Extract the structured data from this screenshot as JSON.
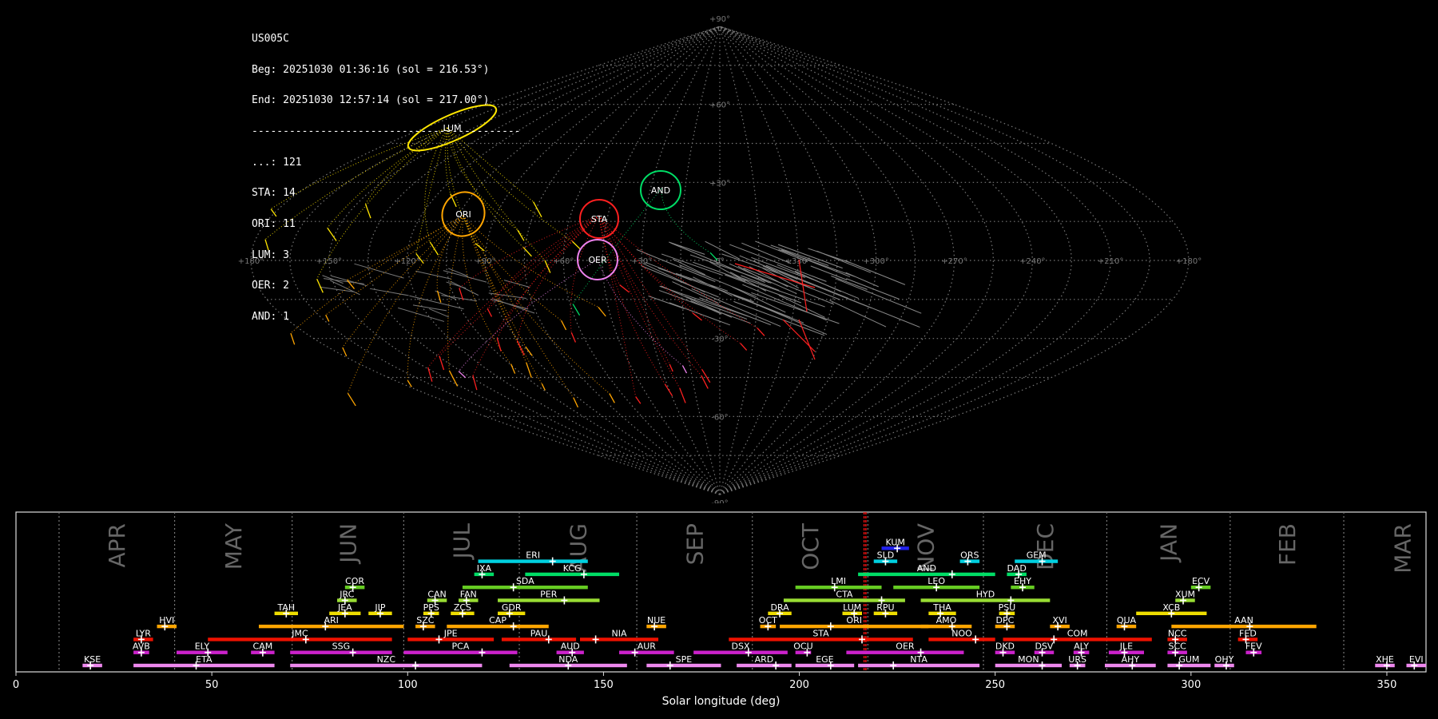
{
  "info": {
    "station": "US005C",
    "begin": "Beg: 20251030 01:36:16 (sol = 216.53°)",
    "end": "End: 20251030 12:57:14 (sol = 217.00°)",
    "separator": "-------------------------------------------",
    "counts": [
      "...: 121",
      "STA: 14",
      "ORI: 11",
      "LUM: 3",
      "OER: 2",
      "AND: 1"
    ]
  },
  "chart_data": [
    {
      "type": "scatter",
      "description": "Sinusoidal sky map of meteor trails and radiants",
      "lat_ticks": [
        "+90°",
        "+60°",
        "+30°",
        "0°",
        "-30°",
        "-60°",
        "-90°"
      ],
      "lon_ticks": [
        "+180°",
        "+150°",
        "+120°",
        "+90°",
        "+60°",
        "+30°",
        "0°",
        "+330°",
        "+300°",
        "+270°",
        "+240°",
        "+210°",
        "+180°"
      ],
      "grid": true,
      "radiants": [
        {
          "code": "LUM",
          "lon": 103,
          "lat": 48,
          "color": "#ffe600"
        },
        {
          "code": "ORI",
          "lon": 96,
          "lat": 15,
          "color": "#ffa500"
        },
        {
          "code": "STA",
          "lon": 51,
          "lat": 15,
          "color": "#ff2020"
        },
        {
          "code": "AND",
          "lon": 20,
          "lat": 25,
          "color": "#00dd66"
        },
        {
          "code": "OER",
          "lon": 46,
          "lat": 0,
          "color": "#ee82ee"
        }
      ]
    },
    {
      "type": "bar",
      "description": "Meteor shower activity periods vs solar longitude",
      "xlabel": "Solar longitude (deg)",
      "xlim": [
        0,
        360
      ],
      "xticks": [
        0,
        50,
        100,
        150,
        200,
        250,
        300,
        350
      ],
      "months": [
        {
          "name": "APR",
          "start": 11
        },
        {
          "name": "MAY",
          "start": 40.5
        },
        {
          "name": "JUN",
          "start": 70.5
        },
        {
          "name": "JUL",
          "start": 99
        },
        {
          "name": "AUG",
          "start": 128.5
        },
        {
          "name": "SEP",
          "start": 158.5
        },
        {
          "name": "OCT",
          "start": 188
        },
        {
          "name": "NOV",
          "start": 217.5
        },
        {
          "name": "DEC",
          "start": 247
        },
        {
          "name": "JAN",
          "start": 278.5
        },
        {
          "name": "FEB",
          "start": 310
        },
        {
          "name": "MAR",
          "start": 339
        }
      ],
      "current_sol": [
        216.53,
        217.0
      ],
      "showers": [
        {
          "code": "KUM",
          "start": 221,
          "end": 228,
          "peak": 225,
          "row": 10,
          "color": "#2222ee"
        },
        {
          "code": "ERI",
          "start": 118,
          "end": 146,
          "peak": 137,
          "row": 9,
          "color": "#00d0e0"
        },
        {
          "code": "SLD",
          "start": 219,
          "end": 225,
          "peak": 222,
          "row": 9,
          "color": "#00d0e0"
        },
        {
          "code": "ORS",
          "start": 241,
          "end": 246,
          "peak": 243,
          "row": 9,
          "color": "#00d0e0"
        },
        {
          "code": "GEM",
          "start": 255,
          "end": 266,
          "peak": 262,
          "row": 9,
          "color": "#00d0e0"
        },
        {
          "code": "IXA",
          "start": 117,
          "end": 122,
          "peak": 119,
          "row": 8,
          "color": "#00dd66"
        },
        {
          "code": "KCG",
          "start": 130,
          "end": 154,
          "peak": 145,
          "row": 8,
          "color": "#00dd66"
        },
        {
          "code": "AND",
          "start": 215,
          "end": 250,
          "peak": 239,
          "row": 8,
          "color": "#00dd66"
        },
        {
          "code": "DAD",
          "start": 253,
          "end": 258,
          "peak": 256,
          "row": 8,
          "color": "#00dd66"
        },
        {
          "code": "COR",
          "start": 84,
          "end": 89,
          "peak": 86,
          "row": 7,
          "color": "#66cc22"
        },
        {
          "code": "SDA",
          "start": 114,
          "end": 146,
          "peak": 127,
          "row": 7,
          "color": "#66cc22"
        },
        {
          "code": "LMI",
          "start": 199,
          "end": 221,
          "peak": 209,
          "row": 7,
          "color": "#66cc22"
        },
        {
          "code": "LEO",
          "start": 224,
          "end": 246,
          "peak": 235,
          "row": 7,
          "color": "#66cc22"
        },
        {
          "code": "EHY",
          "start": 254,
          "end": 260,
          "peak": 257,
          "row": 7,
          "color": "#66cc22"
        },
        {
          "code": "ECV",
          "start": 300,
          "end": 305,
          "peak": 302,
          "row": 7,
          "color": "#66cc22"
        },
        {
          "code": "JRC",
          "start": 82,
          "end": 87,
          "peak": 84,
          "row": 6,
          "color": "#99dd33"
        },
        {
          "code": "CAN",
          "start": 105,
          "end": 110,
          "peak": 107,
          "row": 6,
          "color": "#99dd33"
        },
        {
          "code": "FAN",
          "start": 113,
          "end": 118,
          "peak": 115,
          "row": 6,
          "color": "#99dd33"
        },
        {
          "code": "PER",
          "start": 123,
          "end": 149,
          "peak": 140,
          "row": 6,
          "color": "#99dd33"
        },
        {
          "code": "CTA",
          "start": 196,
          "end": 227,
          "peak": 221,
          "row": 6,
          "color": "#99dd33"
        },
        {
          "code": "HYD",
          "start": 231,
          "end": 264,
          "peak": 254,
          "row": 6,
          "color": "#99dd33"
        },
        {
          "code": "XUM",
          "start": 296,
          "end": 301,
          "peak": 298,
          "row": 6,
          "color": "#99dd33"
        },
        {
          "code": "TAH",
          "start": 66,
          "end": 72,
          "peak": 69,
          "row": 5,
          "color": "#eedd00"
        },
        {
          "code": "JEA",
          "start": 80,
          "end": 88,
          "peak": 84,
          "row": 5,
          "color": "#eedd00"
        },
        {
          "code": "JIP",
          "start": 90,
          "end": 96,
          "peak": 93,
          "row": 5,
          "color": "#eedd00"
        },
        {
          "code": "PPS",
          "start": 104,
          "end": 108,
          "peak": 106,
          "row": 5,
          "color": "#eedd00"
        },
        {
          "code": "ZCS",
          "start": 111,
          "end": 117,
          "peak": 114,
          "row": 5,
          "color": "#eedd00"
        },
        {
          "code": "GDR",
          "start": 123,
          "end": 130,
          "peak": 126,
          "row": 5,
          "color": "#eedd00"
        },
        {
          "code": "DRA",
          "start": 192,
          "end": 198,
          "peak": 195,
          "row": 5,
          "color": "#eedd00"
        },
        {
          "code": "LUM",
          "start": 211,
          "end": 216,
          "peak": 214,
          "row": 5,
          "color": "#eedd00"
        },
        {
          "code": "RPU",
          "start": 219,
          "end": 225,
          "peak": 222,
          "row": 5,
          "color": "#eedd00"
        },
        {
          "code": "THA",
          "start": 233,
          "end": 240,
          "peak": 236,
          "row": 5,
          "color": "#eedd00"
        },
        {
          "code": "PSU",
          "start": 251,
          "end": 255,
          "peak": 253,
          "row": 5,
          "color": "#eedd00"
        },
        {
          "code": "XCB",
          "start": 286,
          "end": 304,
          "peak": 295,
          "row": 5,
          "color": "#eedd00"
        },
        {
          "code": "HVI",
          "start": 36,
          "end": 41,
          "peak": 38,
          "row": 4,
          "color": "#ffa500"
        },
        {
          "code": "ARI",
          "start": 62,
          "end": 99,
          "peak": 79,
          "row": 4,
          "color": "#ffa500"
        },
        {
          "code": "SZC",
          "start": 102,
          "end": 107,
          "peak": 104,
          "row": 4,
          "color": "#ffa500"
        },
        {
          "code": "CAP",
          "start": 110,
          "end": 136,
          "peak": 127,
          "row": 4,
          "color": "#ffa500"
        },
        {
          "code": "NUE",
          "start": 161,
          "end": 166,
          "peak": 163,
          "row": 4,
          "color": "#ffa500"
        },
        {
          "code": "OCT",
          "start": 190,
          "end": 194,
          "peak": 192,
          "row": 4,
          "color": "#ffa500"
        },
        {
          "code": "ORI",
          "start": 195,
          "end": 233,
          "peak": 208,
          "row": 4,
          "color": "#ffa500"
        },
        {
          "code": "AMO",
          "start": 231,
          "end": 244,
          "peak": 239,
          "row": 4,
          "color": "#ffa500"
        },
        {
          "code": "DPC",
          "start": 250,
          "end": 255,
          "peak": 253,
          "row": 4,
          "color": "#ffa500"
        },
        {
          "code": "XVI",
          "start": 264,
          "end": 269,
          "peak": 266,
          "row": 4,
          "color": "#ffa500"
        },
        {
          "code": "QUA",
          "start": 281,
          "end": 286,
          "peak": 283,
          "row": 4,
          "color": "#ffa500"
        },
        {
          "code": "AAN",
          "start": 295,
          "end": 332,
          "peak": 315,
          "row": 4,
          "color": "#ffa500"
        },
        {
          "code": "LYR",
          "start": 30,
          "end": 35,
          "peak": 32,
          "row": 3,
          "color": "#ee1100"
        },
        {
          "code": "JMC",
          "start": 49,
          "end": 96,
          "peak": 74,
          "row": 3,
          "color": "#ee1100"
        },
        {
          "code": "JPE",
          "start": 100,
          "end": 122,
          "peak": 108,
          "row": 3,
          "color": "#ee1100"
        },
        {
          "code": "PAU",
          "start": 124,
          "end": 143,
          "peak": 136,
          "row": 3,
          "color": "#ee1100"
        },
        {
          "code": "NIA",
          "start": 144,
          "end": 164,
          "peak": 148,
          "row": 3,
          "color": "#ee1100"
        },
        {
          "code": "STA",
          "start": 182,
          "end": 229,
          "peak": 216,
          "row": 3,
          "color": "#ee1100"
        },
        {
          "code": "NOO",
          "start": 233,
          "end": 250,
          "peak": 245,
          "row": 3,
          "color": "#ee1100"
        },
        {
          "code": "COM",
          "start": 252,
          "end": 290,
          "peak": 265,
          "row": 3,
          "color": "#ee1100"
        },
        {
          "code": "NCC",
          "start": 294,
          "end": 299,
          "peak": 296,
          "row": 3,
          "color": "#ee1100"
        },
        {
          "code": "FED",
          "start": 312,
          "end": 317,
          "peak": 314,
          "row": 3,
          "color": "#ee1100"
        },
        {
          "code": "AVB",
          "start": 30,
          "end": 34,
          "peak": 32,
          "row": 2,
          "color": "#cc22cc"
        },
        {
          "code": "ELY",
          "start": 41,
          "end": 54,
          "peak": 49,
          "row": 2,
          "color": "#cc22cc"
        },
        {
          "code": "CAM",
          "start": 60,
          "end": 66,
          "peak": 63,
          "row": 2,
          "color": "#cc22cc"
        },
        {
          "code": "SSG",
          "start": 70,
          "end": 96,
          "peak": 86,
          "row": 2,
          "color": "#cc22cc"
        },
        {
          "code": "PCA",
          "start": 99,
          "end": 128,
          "peak": 119,
          "row": 2,
          "color": "#cc22cc"
        },
        {
          "code": "AUD",
          "start": 138,
          "end": 145,
          "peak": 142,
          "row": 2,
          "color": "#cc22cc"
        },
        {
          "code": "AUR",
          "start": 154,
          "end": 168,
          "peak": 158,
          "row": 2,
          "color": "#cc22cc"
        },
        {
          "code": "DSX",
          "start": 173,
          "end": 197,
          "peak": 187,
          "row": 2,
          "color": "#cc22cc"
        },
        {
          "code": "OCU",
          "start": 199,
          "end": 203,
          "peak": 202,
          "row": 2,
          "color": "#cc22cc"
        },
        {
          "code": "OER",
          "start": 212,
          "end": 242,
          "peak": 231,
          "row": 2,
          "color": "#cc22cc"
        },
        {
          "code": "DKD",
          "start": 250,
          "end": 255,
          "peak": 252,
          "row": 2,
          "color": "#cc22cc"
        },
        {
          "code": "DSV",
          "start": 260,
          "end": 265,
          "peak": 262,
          "row": 2,
          "color": "#cc22cc"
        },
        {
          "code": "ALY",
          "start": 270,
          "end": 274,
          "peak": 272,
          "row": 2,
          "color": "#cc22cc"
        },
        {
          "code": "JLE",
          "start": 279,
          "end": 288,
          "peak": 283,
          "row": 2,
          "color": "#cc22cc"
        },
        {
          "code": "SCC",
          "start": 294,
          "end": 299,
          "peak": 296,
          "row": 2,
          "color": "#cc22cc"
        },
        {
          "code": "FEV",
          "start": 314,
          "end": 318,
          "peak": 316,
          "row": 2,
          "color": "#cc22cc"
        },
        {
          "code": "KSE",
          "start": 17,
          "end": 22,
          "peak": 19,
          "row": 1,
          "color": "#ee88ee"
        },
        {
          "code": "ETA",
          "start": 30,
          "end": 66,
          "peak": 46,
          "row": 1,
          "color": "#ee88ee"
        },
        {
          "code": "NZC",
          "start": 70,
          "end": 119,
          "peak": 102,
          "row": 1,
          "color": "#ee88ee"
        },
        {
          "code": "NDA",
          "start": 126,
          "end": 156,
          "peak": 141,
          "row": 1,
          "color": "#ee88ee"
        },
        {
          "code": "SPE",
          "start": 161,
          "end": 180,
          "peak": 167,
          "row": 1,
          "color": "#ee88ee"
        },
        {
          "code": "ARD",
          "start": 184,
          "end": 198,
          "peak": 194,
          "row": 1,
          "color": "#ee88ee"
        },
        {
          "code": "EGE",
          "start": 199,
          "end": 214,
          "peak": 208,
          "row": 1,
          "color": "#ee88ee"
        },
        {
          "code": "NTA",
          "start": 215,
          "end": 246,
          "peak": 224,
          "row": 1,
          "color": "#ee88ee"
        },
        {
          "code": "MON",
          "start": 250,
          "end": 267,
          "peak": 262,
          "row": 1,
          "color": "#ee88ee"
        },
        {
          "code": "URS",
          "start": 269,
          "end": 273,
          "peak": 271,
          "row": 1,
          "color": "#ee88ee"
        },
        {
          "code": "AHY",
          "start": 278,
          "end": 291,
          "peak": 285,
          "row": 1,
          "color": "#ee88ee"
        },
        {
          "code": "GUM",
          "start": 294,
          "end": 305,
          "peak": 297,
          "row": 1,
          "color": "#ee88ee"
        },
        {
          "code": "OHY",
          "start": 306,
          "end": 311,
          "peak": 309,
          "row": 1,
          "color": "#ee88ee"
        },
        {
          "code": "XHE",
          "start": 347,
          "end": 352,
          "peak": 350,
          "row": 1,
          "color": "#ee88ee"
        },
        {
          "code": "EVI",
          "start": 355,
          "end": 360,
          "peak": 357,
          "row": 1,
          "color": "#ee88ee"
        }
      ]
    }
  ]
}
